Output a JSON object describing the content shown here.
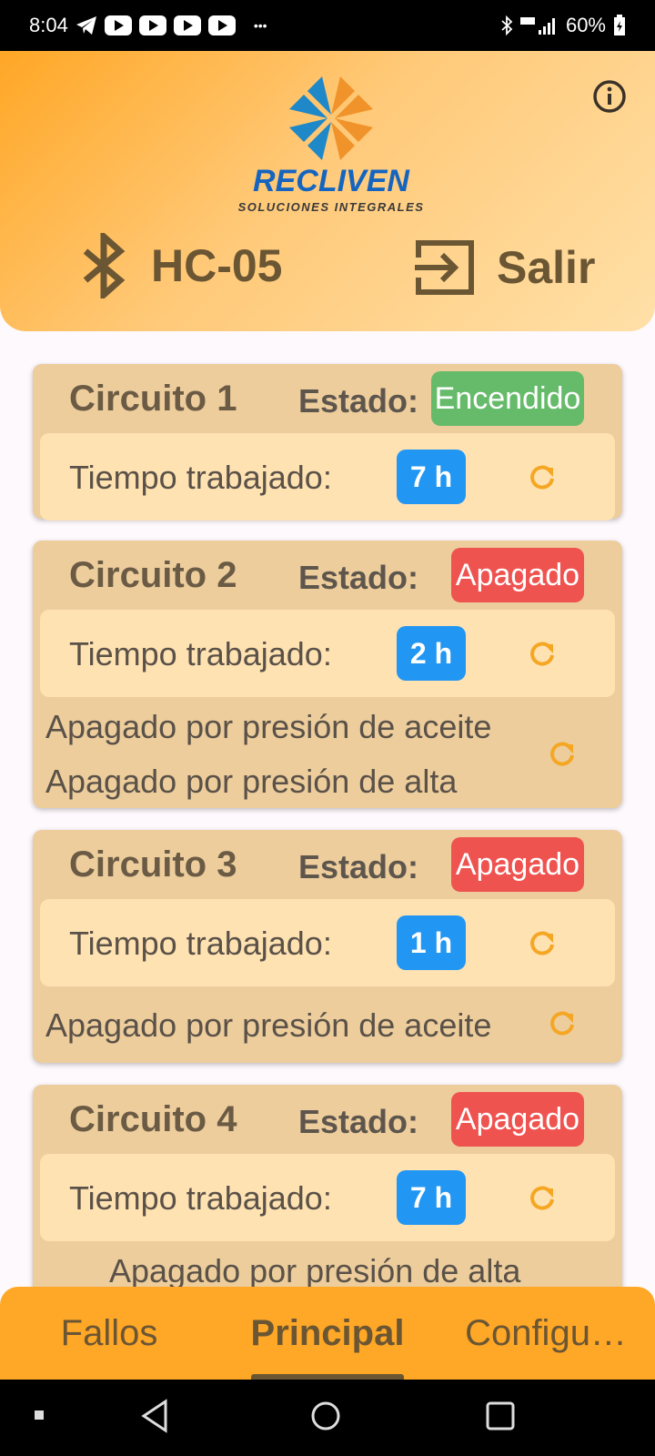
{
  "status_bar": {
    "time": "8:04",
    "battery": "60%",
    "more": "•••"
  },
  "header": {
    "brand": "RECLIVEN",
    "tagline": "SOLUCIONES INTEGRALES",
    "device_name": "HC-05",
    "exit_label": "Salir",
    "icons": [
      "info-icon",
      "bluetooth-icon",
      "exit-icon"
    ]
  },
  "estado_label": "Estado:",
  "tiempo_label": "Tiempo trabajado:",
  "circuits": [
    {
      "name": "Circuito 1",
      "status": "Encendido",
      "status_color": "#66BB6A",
      "hours": "7 h",
      "faults": []
    },
    {
      "name": "Circuito 2",
      "status": "Apagado",
      "status_color": "#EF5350",
      "hours": "2 h",
      "faults": [
        "Apagado por presión de aceite",
        "Apagado por presión de alta"
      ]
    },
    {
      "name": "Circuito 3",
      "status": "Apagado",
      "status_color": "#EF5350",
      "hours": "1 h",
      "faults": [
        "Apagado por presión de aceite"
      ]
    },
    {
      "name": "Circuito 4",
      "status": "Apagado",
      "status_color": "#EF5350",
      "hours": "7 h",
      "faults": [
        "Apagado por presión de alta"
      ]
    }
  ],
  "tabs": [
    "Fallos",
    "Principal",
    "Configu…"
  ],
  "active_tab": "Principal",
  "colors": {
    "accent": "#FFA726",
    "card": "#EDCD9C",
    "inner": "#FFE2B2",
    "hours_badge": "#2196F3",
    "refresh": "#F5A623"
  }
}
